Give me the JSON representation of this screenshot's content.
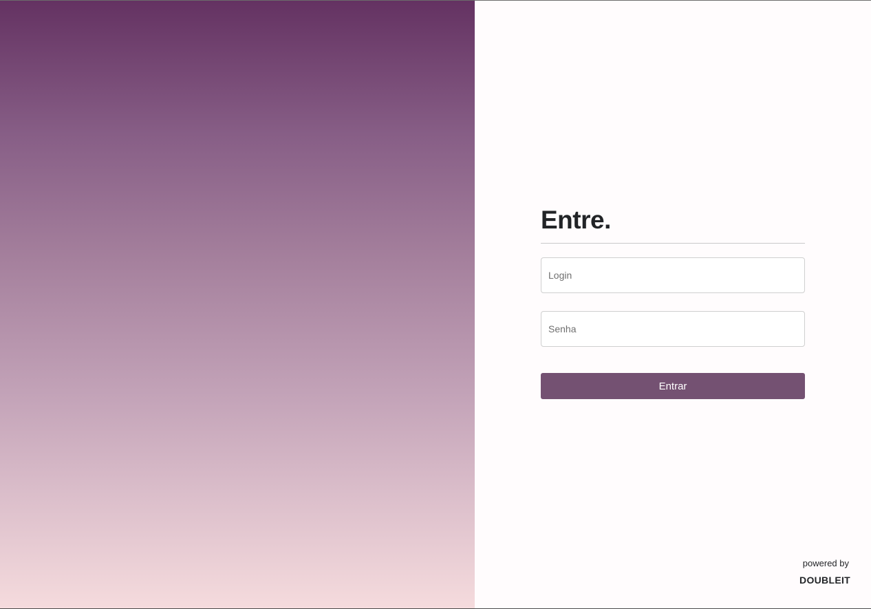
{
  "login_form": {
    "heading": "Entre.",
    "login_field": {
      "placeholder": "Login",
      "value": ""
    },
    "password_field": {
      "placeholder": "Senha",
      "value": ""
    },
    "submit_label": "Entrar"
  },
  "footer": {
    "powered_by_label": "powered by",
    "brand": "DOUBLEIT"
  },
  "colors": {
    "gradient_top": "#643262",
    "gradient_bottom": "#f5dbdd",
    "button_background": "#745172",
    "heading_text": "#222427",
    "page_background": "#fffcfd"
  }
}
